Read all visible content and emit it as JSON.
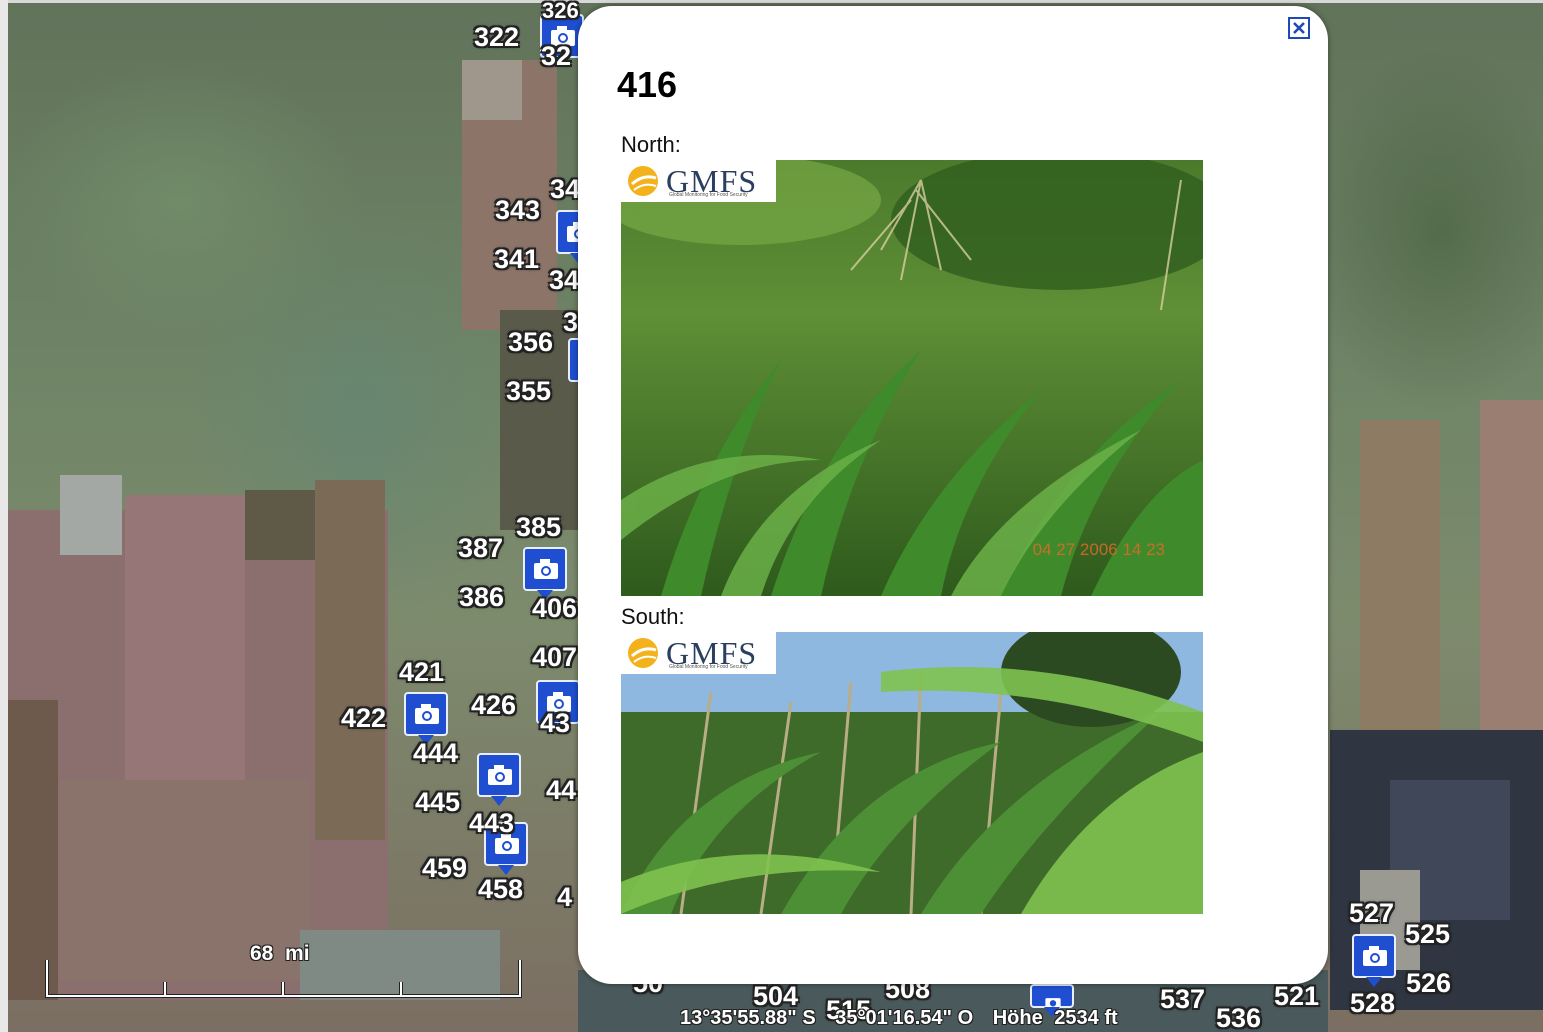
{
  "popup": {
    "title": "416",
    "close_label": "close",
    "photos": [
      {
        "caption": "North:",
        "logo_text": "GMFS",
        "logo_subtitle": "Global Monitoring for Food Security",
        "timestamp": "04 27 2006 14 23"
      },
      {
        "caption": "South:",
        "logo_text": "GMFS",
        "logo_subtitle": "Global Monitoring for Food Security"
      }
    ]
  },
  "map": {
    "placemark_labels": [
      "322",
      "326",
      "32",
      "343",
      "34",
      "341",
      "34",
      "356",
      "3",
      "355",
      "385",
      "387",
      "386",
      "406",
      "407",
      "421",
      "422",
      "426",
      "43",
      "444",
      "445",
      "443",
      "44",
      "459",
      "458",
      "4",
      "504",
      "515",
      "508",
      "537",
      "521",
      "536",
      "527",
      "525",
      "526",
      "528",
      "50"
    ],
    "scale": {
      "value": "68",
      "unit": "mi"
    },
    "status": {
      "latitude": "13°35'55.88\" S",
      "longitude": "35°01'16.54\" O",
      "elevation_label": "Höhe",
      "elevation_value": "2534 ft"
    }
  }
}
